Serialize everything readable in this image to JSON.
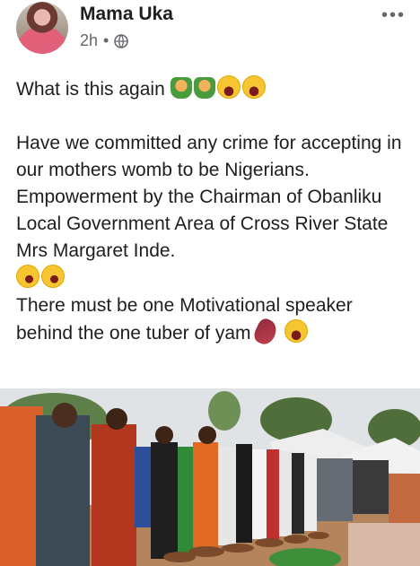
{
  "header": {
    "name": "Mama Uka",
    "time": "2h",
    "separator": "•",
    "more": "•••"
  },
  "post": {
    "line1": "What is this again",
    "para2": "Have we committed any crime for accepting in our mothers womb to be Nigerians.",
    "para3": "Empowerment by the Chairman of Obanliku Local Government Area of Cross River State Mrs Margaret Inde.",
    "para4": "There must be one Motivational speaker behind the one tuber of yam",
    "emojis_line1": [
      "facepalm-icon",
      "facepalm-icon",
      "laughing-icon",
      "laughing-icon"
    ],
    "emojis_line3": [
      "rofl-icon",
      "rofl-icon"
    ],
    "emojis_line4": [
      "sweet-potato-icon",
      "laughing-icon"
    ]
  },
  "colors": {
    "text": "#1c1e21",
    "meta": "#65676b"
  }
}
